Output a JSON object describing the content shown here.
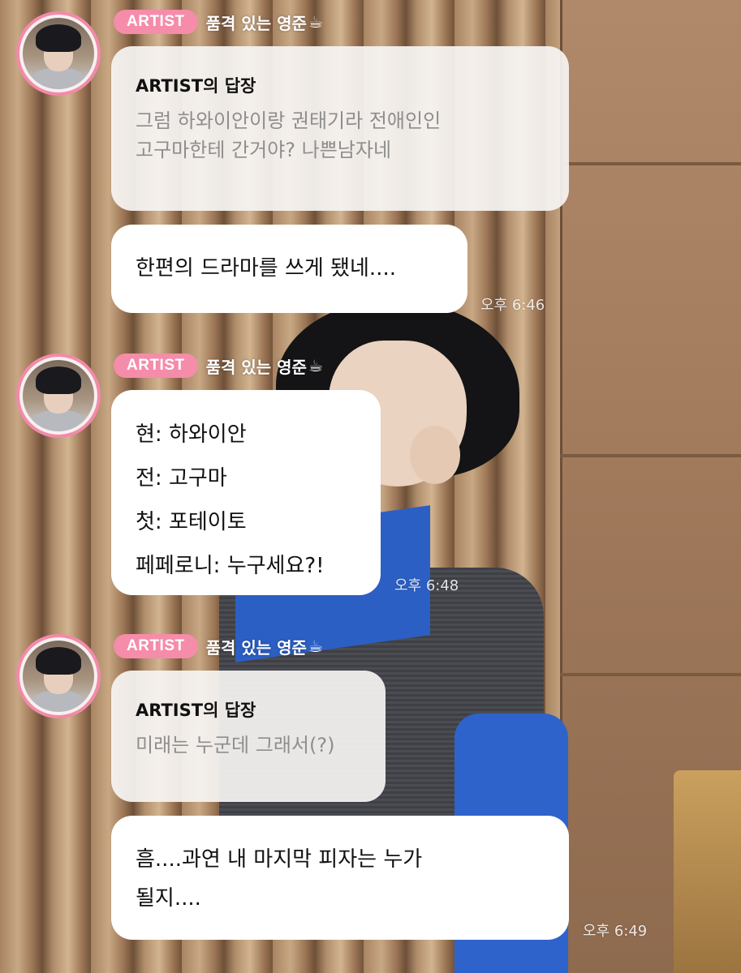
{
  "messages": [
    {
      "badge": "ARTIST",
      "nickname": "품격 있는 영준",
      "nickname_icon": "coffee-cup-icon",
      "reply": {
        "title": "ARTIST의 답장",
        "lines": [
          "그럼 하와이안이랑 권태기라 전애인인",
          "고구마한테 간거야? 나쁜남자네"
        ]
      },
      "body_lines": [
        "한편의 드라마를 쓰게 됐네...."
      ],
      "time": "오후 6:46"
    },
    {
      "badge": "ARTIST",
      "nickname": "품격 있는 영준",
      "nickname_icon": "coffee-cup-icon",
      "body_lines": [
        "현: 하와이안",
        "전: 고구마",
        "첫: 포테이토",
        "페페로니: 누구세요?!"
      ],
      "time": "오후 6:48"
    },
    {
      "badge": "ARTIST",
      "nickname": "품격 있는 영준",
      "nickname_icon": "coffee-cup-icon",
      "reply": {
        "title": "ARTIST의 답장",
        "lines": [
          "미래는 누군데 그래서(?)"
        ]
      },
      "body_lines": [
        "흠....과연 내 마지막 피자는 누가",
        "될지...."
      ],
      "time": "오후 6:49"
    }
  ],
  "colors": {
    "badge": "#f58caa",
    "avatar_ring": "#f28aaa",
    "bubble": "#ffffff",
    "reply_bubble": "#f6f4f2",
    "reply_text": "#8e8e8e"
  }
}
